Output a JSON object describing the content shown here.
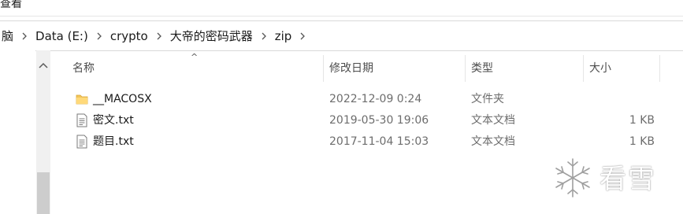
{
  "ribbon": {
    "view_label": "查看"
  },
  "breadcrumb": {
    "items": [
      "脑",
      "Data (E:)",
      "crypto",
      "大帝的密码武器",
      "zip"
    ]
  },
  "columns": {
    "name": "名称",
    "modified": "修改日期",
    "type": "类型",
    "size": "大小"
  },
  "files": [
    {
      "name": "__MACOSX",
      "modified": "2022-12-09 0:24",
      "type": "文件夹",
      "size": "",
      "icon": "folder-icon"
    },
    {
      "name": "密文.txt",
      "modified": "2019-05-30 19:06",
      "type": "文本文档",
      "size": "1 KB",
      "icon": "text-file-icon"
    },
    {
      "name": "题目.txt",
      "modified": "2017-11-04 15:03",
      "type": "文本文档",
      "size": "1 KB",
      "icon": "text-file-icon"
    }
  ],
  "watermark": {
    "text": "看雪"
  },
  "colors": {
    "folder": "#f3c55a",
    "header_text": "#4d4d4d",
    "meta_text": "#6d6d6d"
  }
}
